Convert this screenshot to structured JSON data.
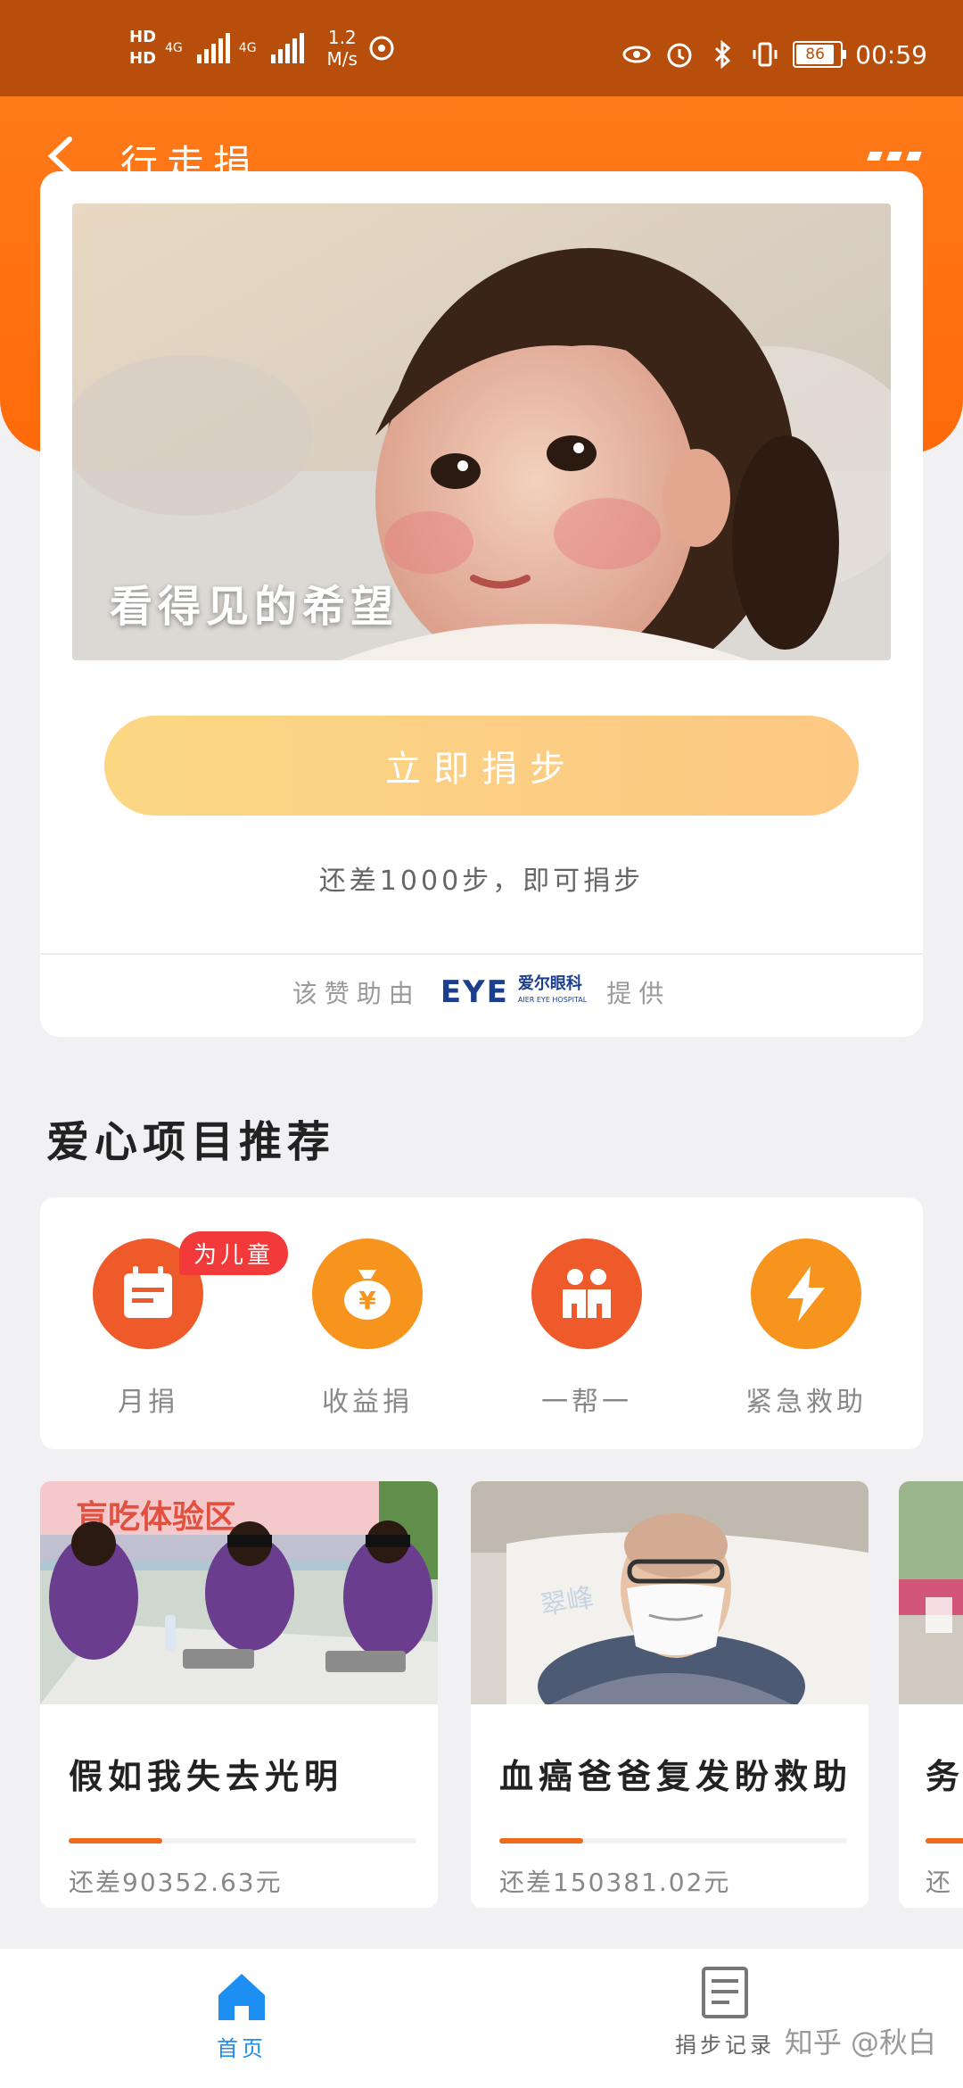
{
  "status_bar": {
    "hd1": "HD",
    "hd2": "HD",
    "net1": "4G",
    "net2": "4G",
    "speed_value": "1.2",
    "speed_unit": "M/s",
    "battery": "86",
    "time": "00:59"
  },
  "header": {
    "title": "行走捐"
  },
  "hero": {
    "caption": "看得见的希望"
  },
  "donate": {
    "button_label": "立即捐步",
    "remaining_text": "还差1000步，即可捐步"
  },
  "sponsor": {
    "prefix": "该赞助由",
    "logo_mark": "EYE",
    "logo_cn": "爱尔眼科",
    "logo_en": "AIER EYE HOSPITAL",
    "suffix": "提供"
  },
  "section": {
    "title": "爱心项目推荐"
  },
  "categories": [
    {
      "label": "月捐",
      "color": "#ef5a2b",
      "icon": "calendar-icon"
    },
    {
      "label": "收益捐",
      "color": "#f7941d",
      "icon": "money-bag-icon"
    },
    {
      "label": "一帮一",
      "color": "#ef5a2b",
      "icon": "pair-icon"
    },
    {
      "label": "紧急救助",
      "color": "#f7941d",
      "icon": "lightning-icon"
    }
  ],
  "category_badge": "为儿童",
  "projects": [
    {
      "title": "假如我失去光明",
      "remaining": "还差90352.63元",
      "progress": 0.27,
      "banner_text": "盲吃体验区"
    },
    {
      "title": "血癌爸爸复发盼救助",
      "remaining": "还差150381.02元",
      "progress": 0.24
    },
    {
      "title": "务",
      "remaining": "还",
      "progress": 0.5
    }
  ],
  "bottom_nav": {
    "home_label": "首页",
    "records_label": "捐步记录"
  },
  "watermark": "知乎 @秋白",
  "colors": {
    "accent": "#ff6a0a",
    "status_bar": "#b84e0b",
    "button": "#fbd784",
    "nav_active": "#1d8ef2"
  }
}
